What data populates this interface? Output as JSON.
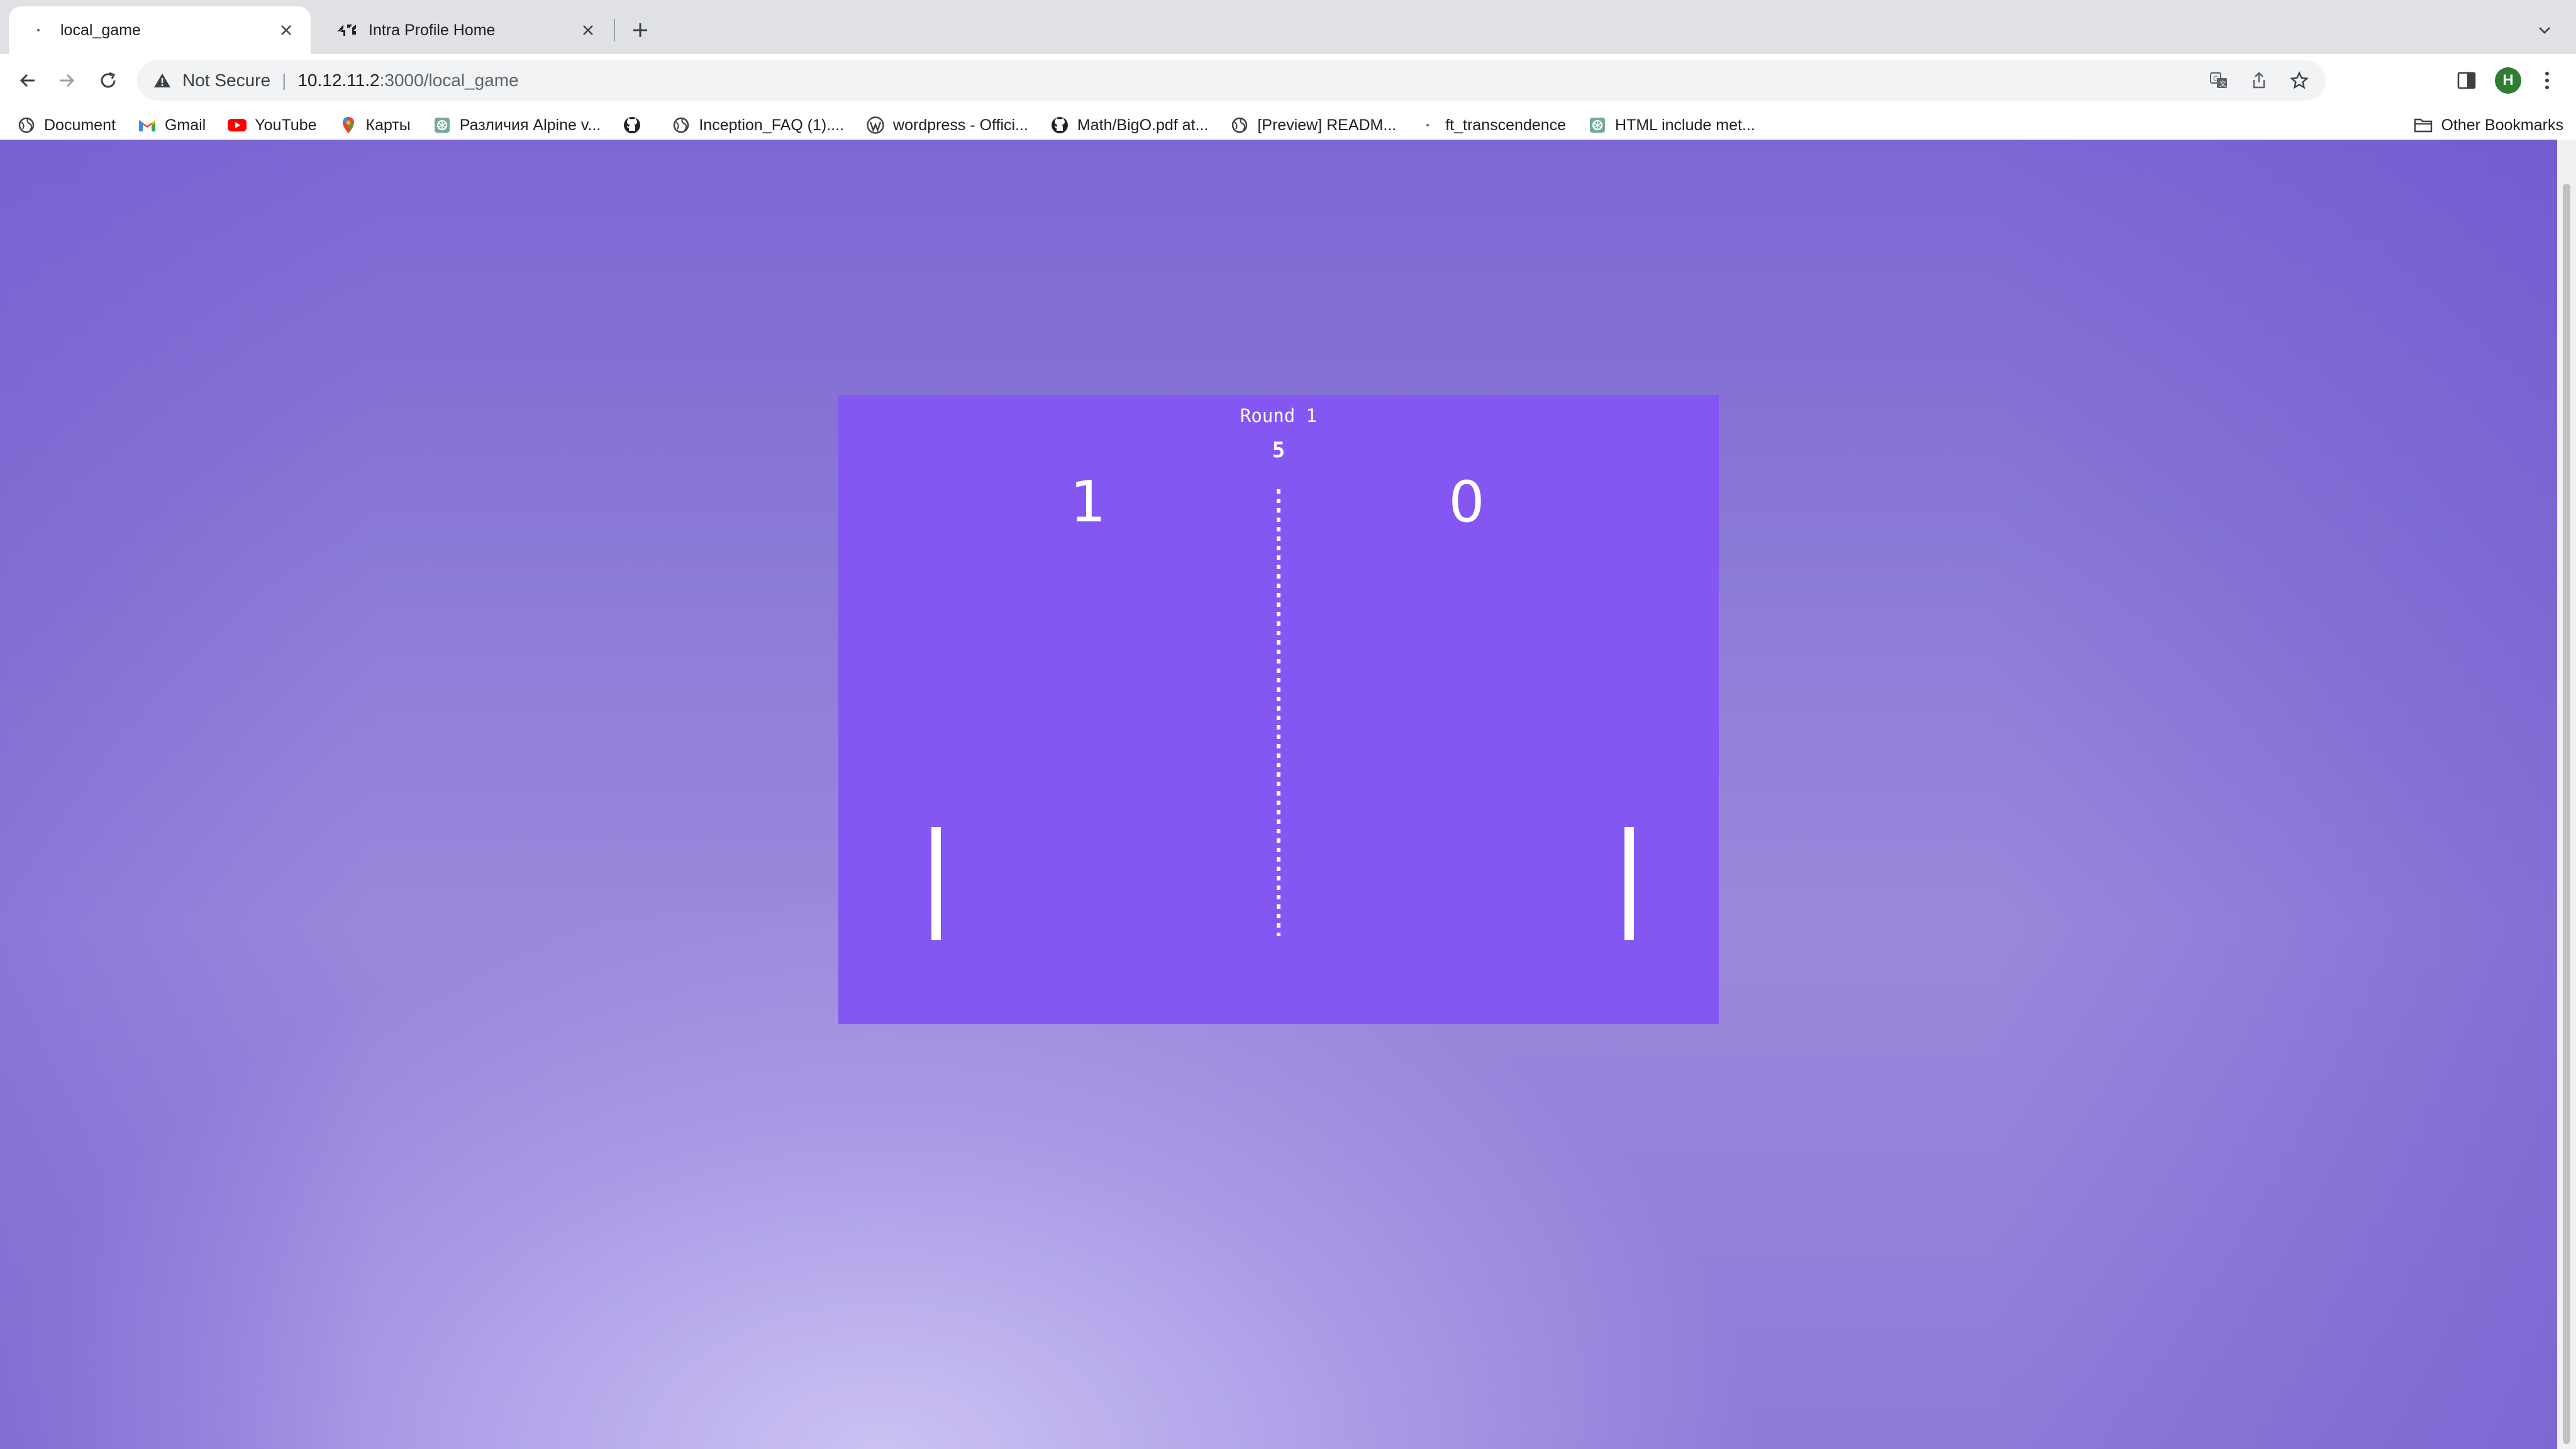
{
  "tabs": [
    {
      "title": "local_game",
      "favicon": "dot-icon",
      "active": true
    },
    {
      "title": "Intra Profile Home",
      "favicon": "42-logo-icon",
      "active": false
    }
  ],
  "address_bar": {
    "security_label": "Not Secure",
    "host": "10.12.11.2",
    "path": ":3000/local_game"
  },
  "profile": {
    "initial": "H",
    "color": "#2e7d32"
  },
  "bookmarks": [
    {
      "label": "Document",
      "icon": "globe-icon"
    },
    {
      "label": "Gmail",
      "icon": "gmail-icon"
    },
    {
      "label": "YouTube",
      "icon": "youtube-icon"
    },
    {
      "label": "Карты",
      "icon": "maps-pin-icon"
    },
    {
      "label": "Различия Alpine v...",
      "icon": "openai-icon"
    },
    {
      "label": "",
      "icon": "github-icon"
    },
    {
      "label": "Inception_FAQ (1)....",
      "icon": "globe-icon"
    },
    {
      "label": "wordpress - Offici...",
      "icon": "wordpress-icon"
    },
    {
      "label": "Math/BigO.pdf at...",
      "icon": "github-icon"
    },
    {
      "label": "[Preview] READM...",
      "icon": "globe-icon"
    },
    {
      "label": "ft_transcendence",
      "icon": "dot-icon"
    },
    {
      "label": "HTML include met...",
      "icon": "openai-icon"
    }
  ],
  "other_bookmarks": "Other Bookmarks",
  "game": {
    "round_label": "Round 1",
    "timer": "5",
    "score_left": "1",
    "score_right": "0"
  },
  "colors": {
    "board": "#8457f2",
    "accent": "#7d67d3"
  }
}
